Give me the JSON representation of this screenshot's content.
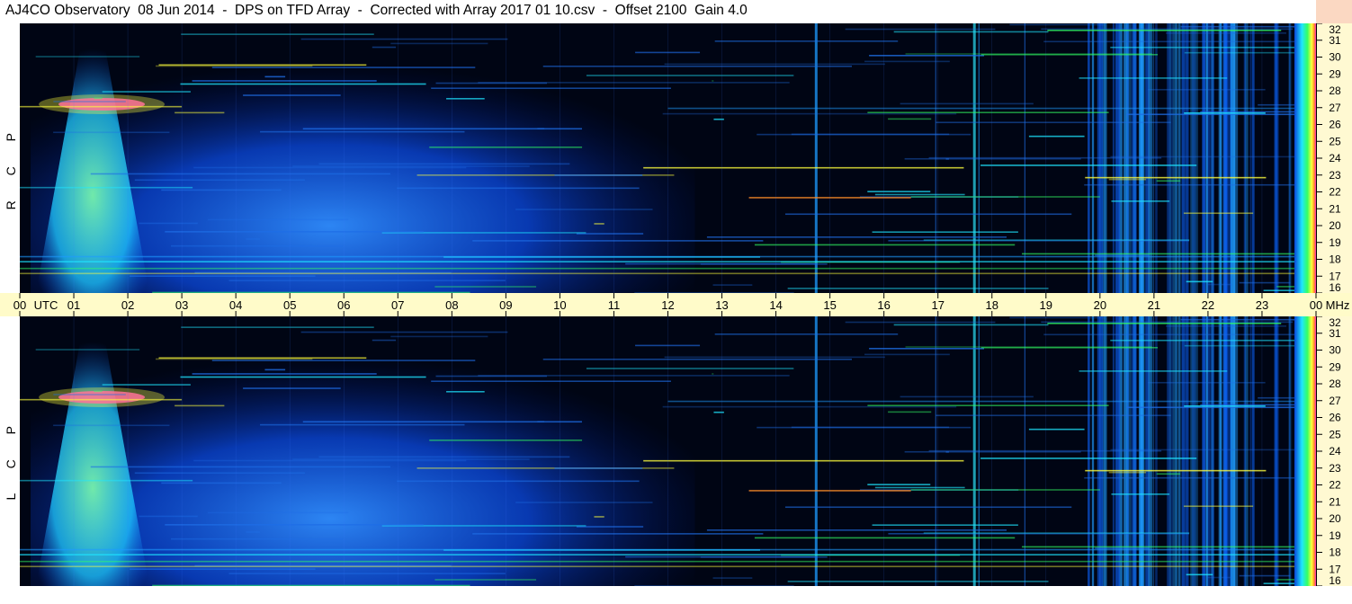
{
  "title": "AJ4CO Observatory  08 Jun 2014  -  DPS on TFD Array  -  Corrected with Array 2017 01 10.csv  -  Offset 2100  Gain 4.0",
  "chart_data": [
    {
      "type": "heatmap",
      "panel": "top",
      "ylabel": "R C P",
      "x_range_utc_hours": [
        0,
        24
      ],
      "y_range_mhz": [
        16,
        32
      ],
      "y_ticks": [
        "16",
        "17",
        "18",
        "19",
        "20",
        "21",
        "22",
        "23",
        "24",
        "25",
        "26",
        "27",
        "28",
        "29",
        "30",
        "31",
        "32"
      ],
      "features": [
        {
          "name": "burst",
          "t_start": 0.3,
          "t_end": 2.4,
          "f_low": 16,
          "f_high": 30.5
        },
        {
          "name": "diffuse-glow",
          "t_start": 0.2,
          "t_end": 12.5,
          "f_low": 16,
          "f_high": 32
        },
        {
          "name": "high-edge",
          "t_start": 23.6,
          "t_end": 24,
          "f_low": 16,
          "f_high": 32
        }
      ]
    },
    {
      "type": "heatmap",
      "panel": "bottom",
      "ylabel": "L C P",
      "x_range_utc_hours": [
        0,
        24
      ],
      "y_range_mhz": [
        16,
        32
      ],
      "y_ticks": [
        "16",
        "17",
        "18",
        "19",
        "20",
        "21",
        "22",
        "23",
        "24",
        "25",
        "26",
        "27",
        "28",
        "29",
        "30",
        "31",
        "32"
      ],
      "features": [
        {
          "name": "burst",
          "t_start": 0.3,
          "t_end": 2.4,
          "f_low": 16,
          "f_high": 30.5
        },
        {
          "name": "diffuse-glow",
          "t_start": 0.2,
          "t_end": 12.5,
          "f_low": 16,
          "f_high": 32
        },
        {
          "name": "high-edge",
          "t_start": 23.6,
          "t_end": 24,
          "f_low": 16,
          "f_high": 32
        }
      ]
    }
  ],
  "time_axis": {
    "ticks": [
      "00",
      "01",
      "02",
      "03",
      "04",
      "05",
      "06",
      "07",
      "08",
      "09",
      "10",
      "11",
      "12",
      "13",
      "14",
      "15",
      "16",
      "17",
      "18",
      "19",
      "20",
      "21",
      "22",
      "23",
      "00"
    ],
    "unit_label": "UTC",
    "freq_unit_label": "MHz"
  },
  "colors": {
    "background": "#000514",
    "blue": "#0a3cc8",
    "cyan": "#1ee6ff",
    "green": "#32ff64",
    "yellow": "#ffff3c",
    "orange": "#ff8c28",
    "magenta": "#ff28c8",
    "axis_bg": "#fffbc9",
    "freq_axis_bg": "#fff9d2",
    "corner": "#fbd8c2"
  }
}
